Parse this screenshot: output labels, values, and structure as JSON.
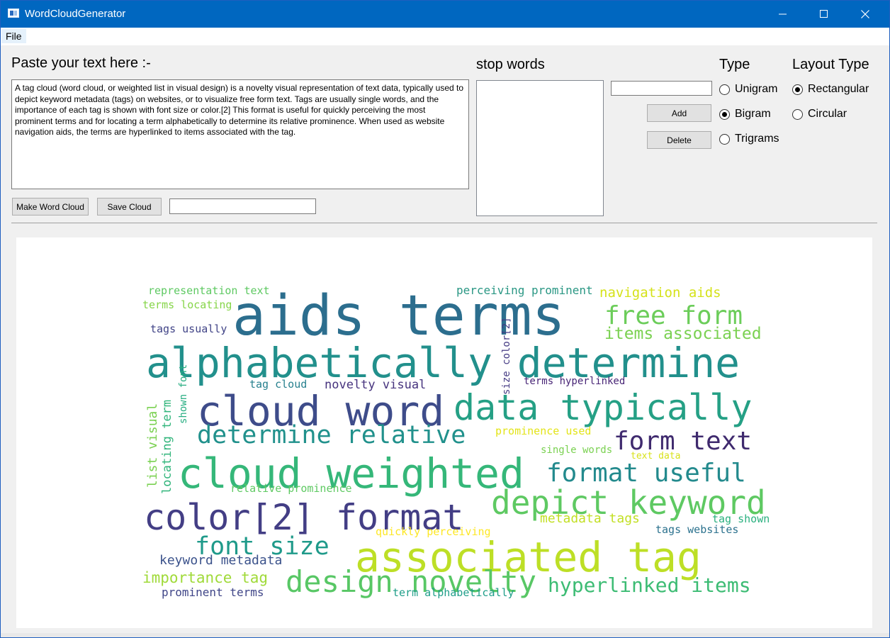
{
  "window": {
    "title": "WordCloudGenerator"
  },
  "menu": {
    "file": "File"
  },
  "input": {
    "heading": "Paste your text here :-",
    "text": "A tag cloud (word cloud, or weighted list in visual design) is a novelty visual representation of text data, typically used to depict keyword metadata (tags) on websites, or to visualize free form text. Tags are usually single words, and the importance of each tag is shown with font size or color.[2] This format is useful for quickly perceiving the most prominent terms and for locating a term alphabetically to determine its relative prominence. When used as website navigation aids, the terms are hyperlinked to items associated with the tag."
  },
  "actions": {
    "make": "Make Word Cloud",
    "save": "Save Cloud",
    "filename": ""
  },
  "stopwords": {
    "heading": "stop words",
    "new_word": "",
    "add": "Add",
    "delete": "Delete",
    "items": []
  },
  "type": {
    "heading": "Type",
    "options": [
      {
        "label": "Unigram",
        "selected": false
      },
      {
        "label": "Bigram",
        "selected": true
      },
      {
        "label": "Trigrams",
        "selected": false
      }
    ]
  },
  "layout": {
    "heading": "Layout Type",
    "options": [
      {
        "label": "Rectangular",
        "selected": true
      },
      {
        "label": "Circular",
        "selected": false
      }
    ]
  },
  "cloud": {
    "words": [
      {
        "text": "aids terms",
        "color": "#2c6e8e"
      },
      {
        "text": "alphabetically determine",
        "color": "#22908c"
      },
      {
        "text": "cloud word",
        "color": "#3e4c8a"
      },
      {
        "text": "data typically",
        "color": "#25a085"
      },
      {
        "text": "determine relative",
        "color": "#21918c"
      },
      {
        "text": "cloud weighted",
        "color": "#35b779"
      },
      {
        "text": "color[2] format",
        "color": "#433e85"
      },
      {
        "text": "associated tag",
        "color": "#bddf26"
      },
      {
        "text": "depict keyword",
        "color": "#5ec962"
      },
      {
        "text": "design novelty",
        "color": "#58c765"
      },
      {
        "text": "font size",
        "color": "#1f9a8a"
      },
      {
        "text": "form text",
        "color": "#3f2a6e"
      },
      {
        "text": "format useful",
        "color": "#238a8d"
      },
      {
        "text": "free form",
        "color": "#6ccd5a"
      },
      {
        "text": "items associated",
        "color": "#7ad151"
      },
      {
        "text": "hyperlinked items",
        "color": "#3dbc74"
      },
      {
        "text": "representation text",
        "color": "#5ec962"
      },
      {
        "text": "terms locating",
        "color": "#86d549"
      },
      {
        "text": "tags usually",
        "color": "#414487"
      },
      {
        "text": "perceiving prominent",
        "color": "#2a9784"
      },
      {
        "text": "navigation aids",
        "color": "#d5e21a"
      },
      {
        "text": "size color[2]",
        "color": "#443a83"
      },
      {
        "text": "tag cloud",
        "color": "#27808e"
      },
      {
        "text": "novelty visual",
        "color": "#46337e"
      },
      {
        "text": "terms hyperlinked",
        "color": "#482576"
      },
      {
        "text": "shown font",
        "color": "#26ad81"
      },
      {
        "text": "list visual",
        "color": "#7ad151"
      },
      {
        "text": "locating term",
        "color": "#31b57b"
      },
      {
        "text": "prominence used",
        "color": "#e3e418"
      },
      {
        "text": "single words",
        "color": "#7ad151"
      },
      {
        "text": "text data",
        "color": "#d8e219"
      },
      {
        "text": "relative prominence",
        "color": "#5ec962"
      },
      {
        "text": "metadata tags",
        "color": "#c2df23"
      },
      {
        "text": "tag shown",
        "color": "#2ab07f"
      },
      {
        "text": "quickly perceiving",
        "color": "#fde725"
      },
      {
        "text": "tags websites",
        "color": "#2c728e"
      },
      {
        "text": "keyword metadata",
        "color": "#3b528b"
      },
      {
        "text": "importance tag",
        "color": "#a0da39"
      },
      {
        "text": "prominent terms",
        "color": "#404688"
      },
      {
        "text": "term alphabetically",
        "color": "#1f9e89"
      }
    ]
  }
}
